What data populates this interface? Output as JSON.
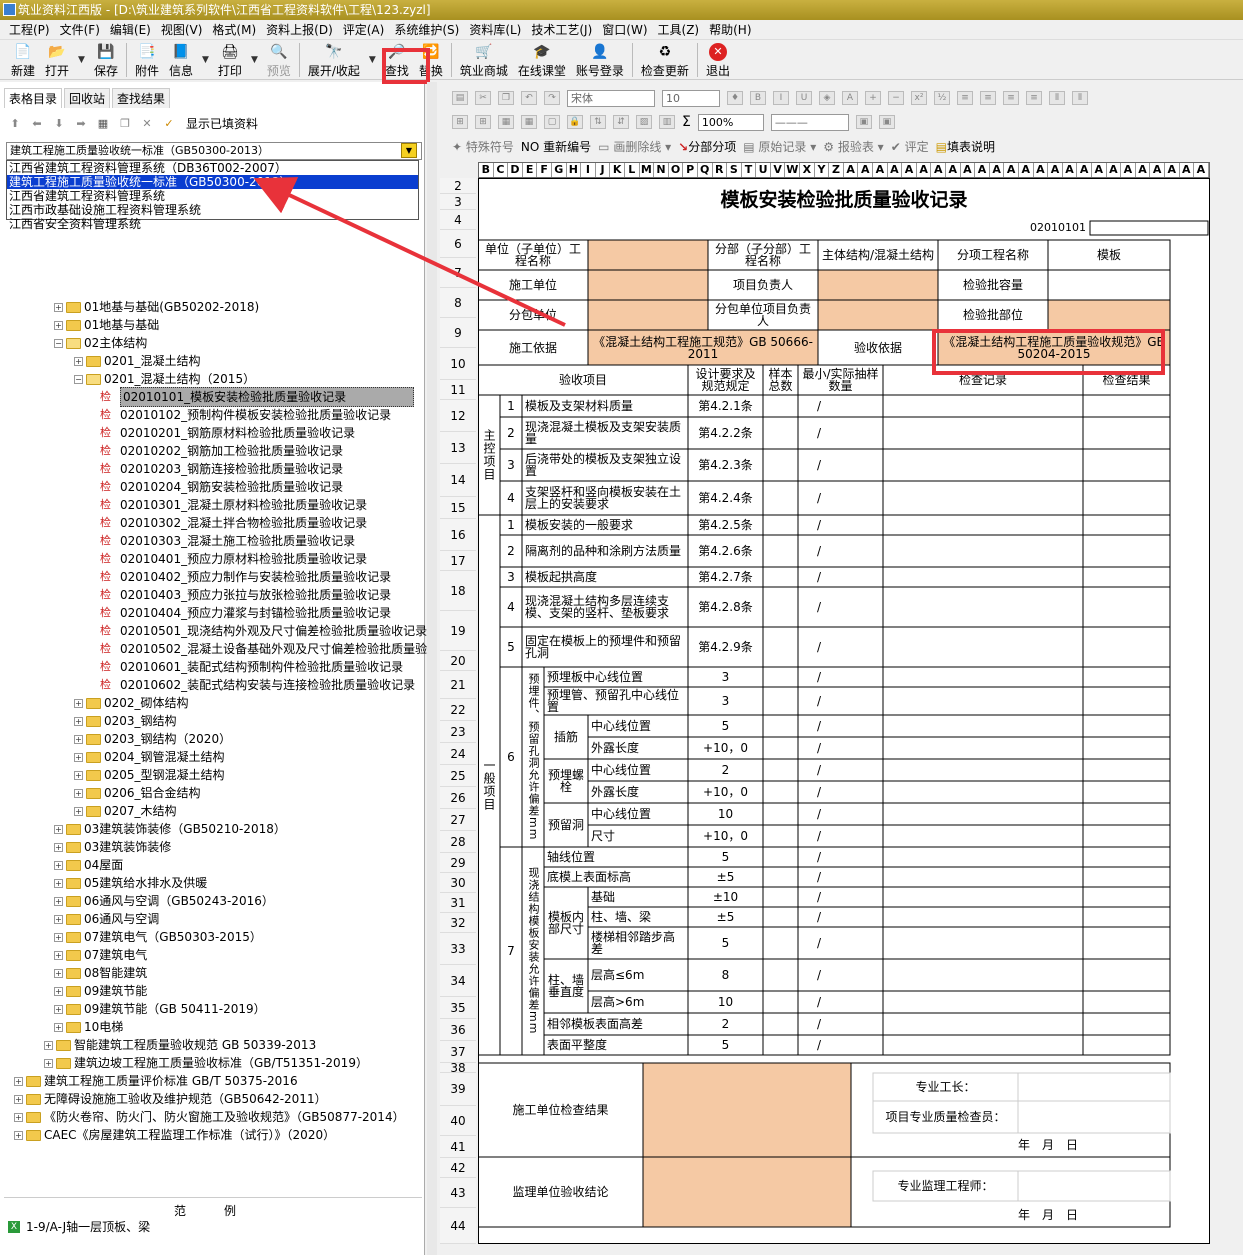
{
  "window": {
    "title": "筑业资料江西版 - [D:\\筑业建筑系列软件\\江西省工程资料软件\\工程\\123.zyzl]"
  },
  "menu": [
    "工程(P)",
    "文件(F)",
    "编辑(E)",
    "视图(V)",
    "格式(M)",
    "资料上报(D)",
    "评定(A)",
    "系统维护(S)",
    "资料库(L)",
    "技术工艺(J)",
    "窗口(W)",
    "工具(Z)",
    "帮助(H)"
  ],
  "toolbar": {
    "new": "新建",
    "open": "打开",
    "save": "保存",
    "attach": "附件",
    "info": "信息",
    "print": "打印",
    "preview": "预览",
    "expand": "展开/收起",
    "find": "查找",
    "replace": "替换",
    "mall": "筑业商城",
    "classroom": "在线课堂",
    "login": "账号登录",
    "update": "检查更新",
    "exit": "退出"
  },
  "left": {
    "tabs": [
      "表格目录",
      "回收站",
      "查找结果"
    ],
    "show_filled": "显示已填资料",
    "combo_value": "建筑工程施工质量验收统一标准（GB50300-2013）",
    "dropdown": [
      "江西省建筑工程资料管理系统（DB36T002-2007）",
      "建筑工程施工质量验收统一标准（GB50300-2013）",
      "江西省建筑工程资料管理系统",
      "江西市政基础设施工程资料管理系统",
      "江西省安全资料管理系统"
    ],
    "tree": [
      {
        "lvl": 2,
        "type": "folder",
        "label": "01地基与基础(GB50202-2018)"
      },
      {
        "lvl": 2,
        "type": "folder",
        "label": "01地基与基础"
      },
      {
        "lvl": 2,
        "type": "folder-open",
        "label": "02主体结构"
      },
      {
        "lvl": 3,
        "type": "folder",
        "label": "0201_混凝土结构"
      },
      {
        "lvl": 3,
        "type": "folder-open",
        "label": "0201_混凝土结构（2015）"
      },
      {
        "lvl": 4,
        "type": "doc",
        "label": "02010101_模板安装检验批质量验收记录",
        "selected": true
      },
      {
        "lvl": 4,
        "type": "doc",
        "label": "02010102_预制构件模板安装检验批质量验收记录"
      },
      {
        "lvl": 4,
        "type": "doc",
        "label": "02010201_钢筋原材料检验批质量验收记录"
      },
      {
        "lvl": 4,
        "type": "doc",
        "label": "02010202_钢筋加工检验批质量验收记录"
      },
      {
        "lvl": 4,
        "type": "doc",
        "label": "02010203_钢筋连接检验批质量验收记录"
      },
      {
        "lvl": 4,
        "type": "doc",
        "label": "02010204_钢筋安装检验批质量验收记录"
      },
      {
        "lvl": 4,
        "type": "doc",
        "label": "02010301_混凝土原材料检验批质量验收记录"
      },
      {
        "lvl": 4,
        "type": "doc",
        "label": "02010302_混凝土拌合物检验批质量验收记录"
      },
      {
        "lvl": 4,
        "type": "doc",
        "label": "02010303_混凝土施工检验批质量验收记录"
      },
      {
        "lvl": 4,
        "type": "doc",
        "label": "02010401_预应力原材料检验批质量验收记录"
      },
      {
        "lvl": 4,
        "type": "doc",
        "label": "02010402_预应力制作与安装检验批质量验收记录"
      },
      {
        "lvl": 4,
        "type": "doc",
        "label": "02010403_预应力张拉与放张检验批质量验收记录"
      },
      {
        "lvl": 4,
        "type": "doc",
        "label": "02010404_预应力灌浆与封锚检验批质量验收记录"
      },
      {
        "lvl": 4,
        "type": "doc",
        "label": "02010501_现浇结构外观及尺寸偏差检验批质量验收记录"
      },
      {
        "lvl": 4,
        "type": "doc",
        "label": "02010502_混凝土设备基础外观及尺寸偏差检验批质量验"
      },
      {
        "lvl": 4,
        "type": "doc",
        "label": "02010601_装配式结构预制构件检验批质量验收记录"
      },
      {
        "lvl": 4,
        "type": "doc",
        "label": "02010602_装配式结构安装与连接检验批质量验收记录"
      },
      {
        "lvl": 3,
        "type": "folder",
        "label": "0202_砌体结构"
      },
      {
        "lvl": 3,
        "type": "folder",
        "label": "0203_钢结构"
      },
      {
        "lvl": 3,
        "type": "folder",
        "label": "0203_钢结构（2020）"
      },
      {
        "lvl": 3,
        "type": "folder",
        "label": "0204_钢管混凝土结构"
      },
      {
        "lvl": 3,
        "type": "folder",
        "label": "0205_型钢混凝土结构"
      },
      {
        "lvl": 3,
        "type": "folder",
        "label": "0206_铝合金结构"
      },
      {
        "lvl": 3,
        "type": "folder",
        "label": "0207_木结构"
      },
      {
        "lvl": 2,
        "type": "folder",
        "label": "03建筑装饰装修（GB50210-2018）"
      },
      {
        "lvl": 2,
        "type": "folder",
        "label": "03建筑装饰装修"
      },
      {
        "lvl": 2,
        "type": "folder",
        "label": "04屋面"
      },
      {
        "lvl": 2,
        "type": "folder",
        "label": "05建筑给水排水及供暖"
      },
      {
        "lvl": 2,
        "type": "folder",
        "label": "06通风与空调（GB50243-2016）"
      },
      {
        "lvl": 2,
        "type": "folder",
        "label": "06通风与空调"
      },
      {
        "lvl": 2,
        "type": "folder",
        "label": "07建筑电气（GB50303-2015）"
      },
      {
        "lvl": 2,
        "type": "folder",
        "label": "07建筑电气"
      },
      {
        "lvl": 2,
        "type": "folder",
        "label": "08智能建筑"
      },
      {
        "lvl": 2,
        "type": "folder",
        "label": "09建筑节能"
      },
      {
        "lvl": 2,
        "type": "folder",
        "label": "09建筑节能（GB 50411-2019）"
      },
      {
        "lvl": 2,
        "type": "folder",
        "label": "10电梯"
      },
      {
        "lvl": 1,
        "type": "folder",
        "label": "智能建筑工程质量验收规范 GB 50339-2013"
      },
      {
        "lvl": 1,
        "type": "folder",
        "label": "建筑边坡工程施工质量验收标准（GB/T51351-2019）"
      },
      {
        "lvl": 0,
        "type": "folder",
        "label": "建筑工程施工质量评价标准 GB/T 50375-2016"
      },
      {
        "lvl": 0,
        "type": "folder",
        "label": "无障碍设施施工验收及维护规范（GB50642-2011）"
      },
      {
        "lvl": 0,
        "type": "folder",
        "label": "《防火卷帘、防火门、防火窗施工及验收规范》（GB50877-2014）"
      },
      {
        "lvl": 0,
        "type": "folder",
        "label": "CAEC《房屋建筑工程监理工作标准（试行）》（2020）"
      }
    ],
    "legend_title": "范例",
    "legend_item": "1-9/A-J轴一层顶板、梁"
  },
  "editor": {
    "font": "宋体",
    "size": "10",
    "zoom": "100%",
    "tb3": [
      "特殊符号",
      "重新编号",
      "画删除线",
      "分部分项",
      "原始记录",
      "报验表",
      "评定",
      "填表说明"
    ],
    "col_letters": [
      "B",
      "C",
      "D",
      "E",
      "F",
      "G",
      "H",
      "I",
      "J",
      "K",
      "L",
      "M",
      "N",
      "O",
      "P",
      "Q",
      "R",
      "S",
      "T",
      "U",
      "V",
      "W",
      "X",
      "Y",
      "Z",
      "A",
      "A",
      "A",
      "A",
      "A",
      "A",
      "A",
      "A",
      "A",
      "A",
      "A",
      "A",
      "A",
      "A",
      "A",
      "A",
      "A",
      "A",
      "A",
      "A",
      "A",
      "A",
      "A",
      "A",
      "A"
    ]
  },
  "form": {
    "title": "模板安装检验批质量验收记录",
    "code": "02010101",
    "unit_label": "单位（子单位）工程名称",
    "subdiv_label": "分部（子分部）工程名称",
    "subdiv_value": "主体结构/混凝土结构",
    "item_label": "分项工程名称",
    "item_value": "模板",
    "constructor_label": "施工单位",
    "pm_label": "项目负责人",
    "capacity_label": "检验批容量",
    "subcontractor_label": "分包单位",
    "sub_pm_label": "分包单位项目负责人",
    "location_label": "检验批部位",
    "basis_label": "施工依据",
    "basis_value": "《混凝土结构工程施工规范》GB 50666-2011",
    "accept_basis_label": "验收依据",
    "accept_basis_value": "《混凝土结构工程施工质量验收规范》GB50204-2015",
    "hdr_item": "验收项目",
    "hdr_design": "设计要求及规范规定",
    "hdr_sample": "样本总数",
    "hdr_min": "最小/实际抽样数量",
    "hdr_record": "检查记录",
    "hdr_result": "检查结果",
    "main_group": "主控项目",
    "general_group": "一般项目",
    "main_items": [
      {
        "n": "1",
        "item": "模板及支架材料质量",
        "rule": "第4.2.1条"
      },
      {
        "n": "2",
        "item": "现浇混凝土模板及支架安装质量",
        "rule": "第4.2.2条"
      },
      {
        "n": "3",
        "item": "后浇带处的模板及支架独立设置",
        "rule": "第4.2.3条"
      },
      {
        "n": "4",
        "item": "支架竖杆和竖向模板安装在土层上的安装要求",
        "rule": "第4.2.4条"
      }
    ],
    "gen_items": [
      {
        "n": "1",
        "item": "模板安装的一般要求",
        "rule": "第4.2.5条"
      },
      {
        "n": "2",
        "item": "隔离剂的品种和涂刷方法质量",
        "rule": "第4.2.6条"
      },
      {
        "n": "3",
        "item": "模板起拱高度",
        "rule": "第4.2.7条"
      },
      {
        "n": "4",
        "item": "现浇混凝土结构多层连续支模、支架的竖杆、垫板要求",
        "rule": "第4.2.8条"
      },
      {
        "n": "5",
        "item": "固定在模板上的预埋件和预留孔洞",
        "rule": "第4.2.9条"
      }
    ],
    "g6_n": "6",
    "g6_label": "预埋件、预留孔洞允许偏差mm",
    "g6_rows": [
      {
        "a": "预埋板中心线位置",
        "b": "",
        "v": "3"
      },
      {
        "a": "预埋管、预留孔中心线位置",
        "b": "",
        "v": "3"
      },
      {
        "a": "插筋",
        "b": "中心线位置",
        "v": "5"
      },
      {
        "a": "",
        "b": "外露长度",
        "v": "+10，0"
      },
      {
        "a": "预埋螺栓",
        "b": "中心线位置",
        "v": "2"
      },
      {
        "a": "",
        "b": "外露长度",
        "v": "+10，0"
      },
      {
        "a": "预留洞",
        "b": "中心线位置",
        "v": "10"
      },
      {
        "a": "",
        "b": "尺寸",
        "v": "+10，0"
      }
    ],
    "g7_n": "7",
    "g7_label": "现浇结构模板安装允许偏差mm",
    "g7_rows": [
      {
        "a": "轴线位置",
        "b": "",
        "v": "5"
      },
      {
        "a": "底模上表面标高",
        "b": "",
        "v": "±5"
      },
      {
        "a": "模板内部尺寸",
        "b": "基础",
        "v": "±10"
      },
      {
        "a": "",
        "b": "柱、墙、梁",
        "v": "±5"
      },
      {
        "a": "",
        "b": "楼梯相邻踏步高差",
        "v": "5"
      },
      {
        "a": "柱、墙垂直度",
        "b": "层高≤6m",
        "v": "8"
      },
      {
        "a": "",
        "b": "层高>6m",
        "v": "10"
      },
      {
        "a": "相邻模板表面高差",
        "b": "",
        "v": "2"
      },
      {
        "a": "表面平整度",
        "b": "",
        "v": "5"
      }
    ],
    "slash": "/",
    "cons_result_label": "施工单位检查结果",
    "foreman_label": "专业工长：",
    "qc_label": "项目专业质量检查员：",
    "date_label": "年　月　日",
    "sup_result_label": "监理单位验收结论",
    "supervisor_label": "专业监理工程师：",
    "row_numbers": [
      "2",
      "3",
      "4",
      "6",
      "7",
      "8",
      "9",
      "10",
      "11",
      "12",
      "13",
      "14",
      "15",
      "16",
      "17",
      "18",
      "19",
      "20",
      "21",
      "22",
      "23",
      "24",
      "25",
      "26",
      "27",
      "28",
      "29",
      "30",
      "31",
      "32",
      "33",
      "34",
      "35",
      "36",
      "37",
      "38",
      "39",
      "40",
      "41",
      "42",
      "43",
      "44"
    ],
    "colors": {
      "fill": "#f5c9a4",
      "highlight": "#e8323a",
      "select": "#0a3ed0"
    }
  }
}
